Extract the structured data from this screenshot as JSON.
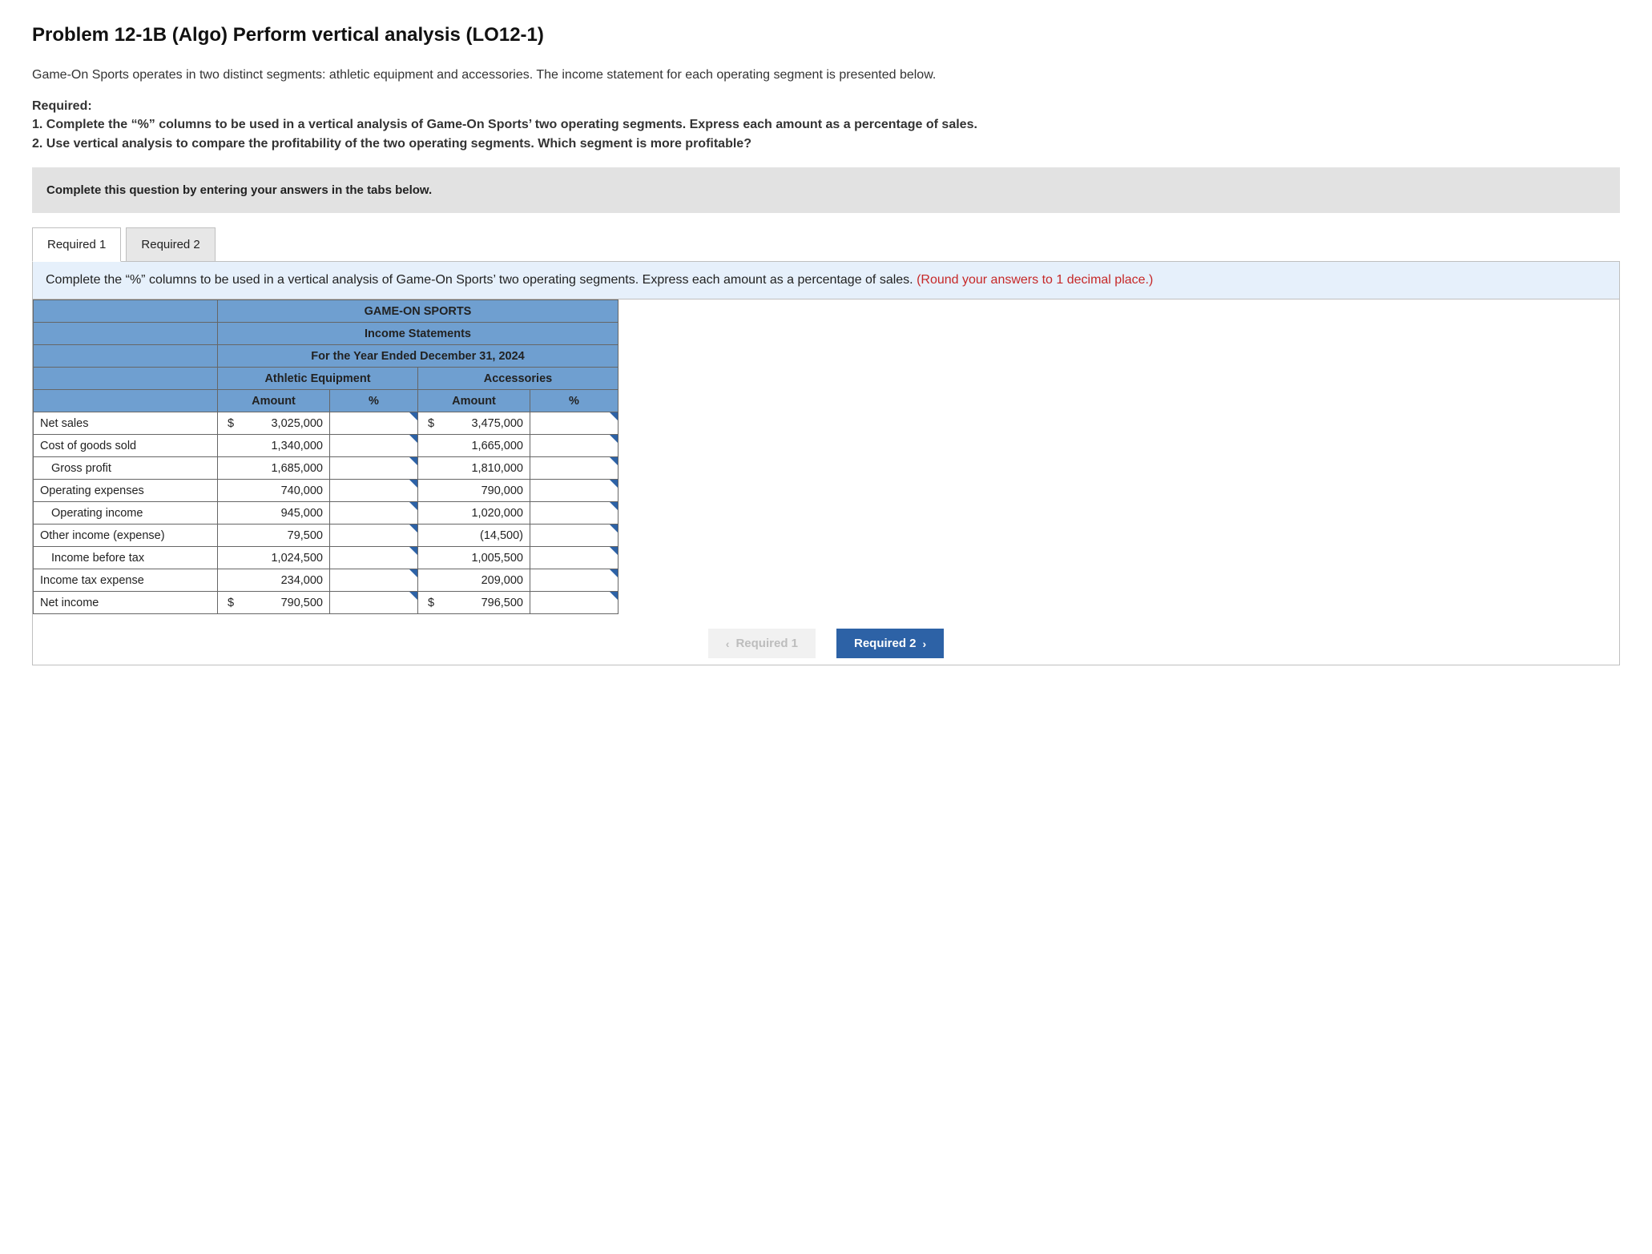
{
  "title": "Problem 12-1B (Algo) Perform vertical analysis (LO12-1)",
  "intro": "Game-On Sports operates in two distinct segments: athletic equipment and accessories. The income statement for each operating segment is presented below.",
  "required_label": "Required:",
  "req1": "1. Complete the “%” columns to be used in a vertical analysis of Game-On Sports’ two operating segments. Express each amount as a percentage of sales.",
  "req2": "2. Use vertical analysis to compare the profitability of the two operating segments. Which segment is more profitable?",
  "instruction_bar": "Complete this question by entering your answers in the tabs below.",
  "tabs": {
    "t1": "Required 1",
    "t2": "Required 2"
  },
  "panel_instruction_main": "Complete the “%” columns to be used in a vertical analysis of Game-On Sports’ two operating segments. Express each amount as a percentage of sales. ",
  "panel_instruction_hint": "(Round your answers to 1 decimal place.)",
  "table": {
    "company": "GAME-ON SPORTS",
    "statement": "Income Statements",
    "period": "For the Year Ended December 31, 2024",
    "seg1": "Athletic Equipment",
    "seg2": "Accessories",
    "col_amount": "Amount",
    "col_pct": "%",
    "rows": [
      {
        "label": "Net sales",
        "indent": 0,
        "a1": "3,025,000",
        "d1": "$",
        "a2": "3,475,000",
        "d2": "$"
      },
      {
        "label": "Cost of goods sold",
        "indent": 0,
        "a1": "1,340,000",
        "d1": "",
        "a2": "1,665,000",
        "d2": ""
      },
      {
        "label": "Gross profit",
        "indent": 1,
        "a1": "1,685,000",
        "d1": "",
        "a2": "1,810,000",
        "d2": ""
      },
      {
        "label": "Operating expenses",
        "indent": 0,
        "a1": "740,000",
        "d1": "",
        "a2": "790,000",
        "d2": ""
      },
      {
        "label": "Operating income",
        "indent": 1,
        "a1": "945,000",
        "d1": "",
        "a2": "1,020,000",
        "d2": ""
      },
      {
        "label": "Other income (expense)",
        "indent": 0,
        "a1": "79,500",
        "d1": "",
        "a2": "(14,500)",
        "d2": ""
      },
      {
        "label": "Income before tax",
        "indent": 1,
        "a1": "1,024,500",
        "d1": "",
        "a2": "1,005,500",
        "d2": ""
      },
      {
        "label": "Income tax expense",
        "indent": 0,
        "a1": "234,000",
        "d1": "",
        "a2": "209,000",
        "d2": ""
      },
      {
        "label": "Net income",
        "indent": 0,
        "a1": "790,500",
        "d1": "$",
        "a2": "796,500",
        "d2": "$"
      }
    ]
  },
  "nav": {
    "prev": "Required 1",
    "next": "Required 2"
  }
}
